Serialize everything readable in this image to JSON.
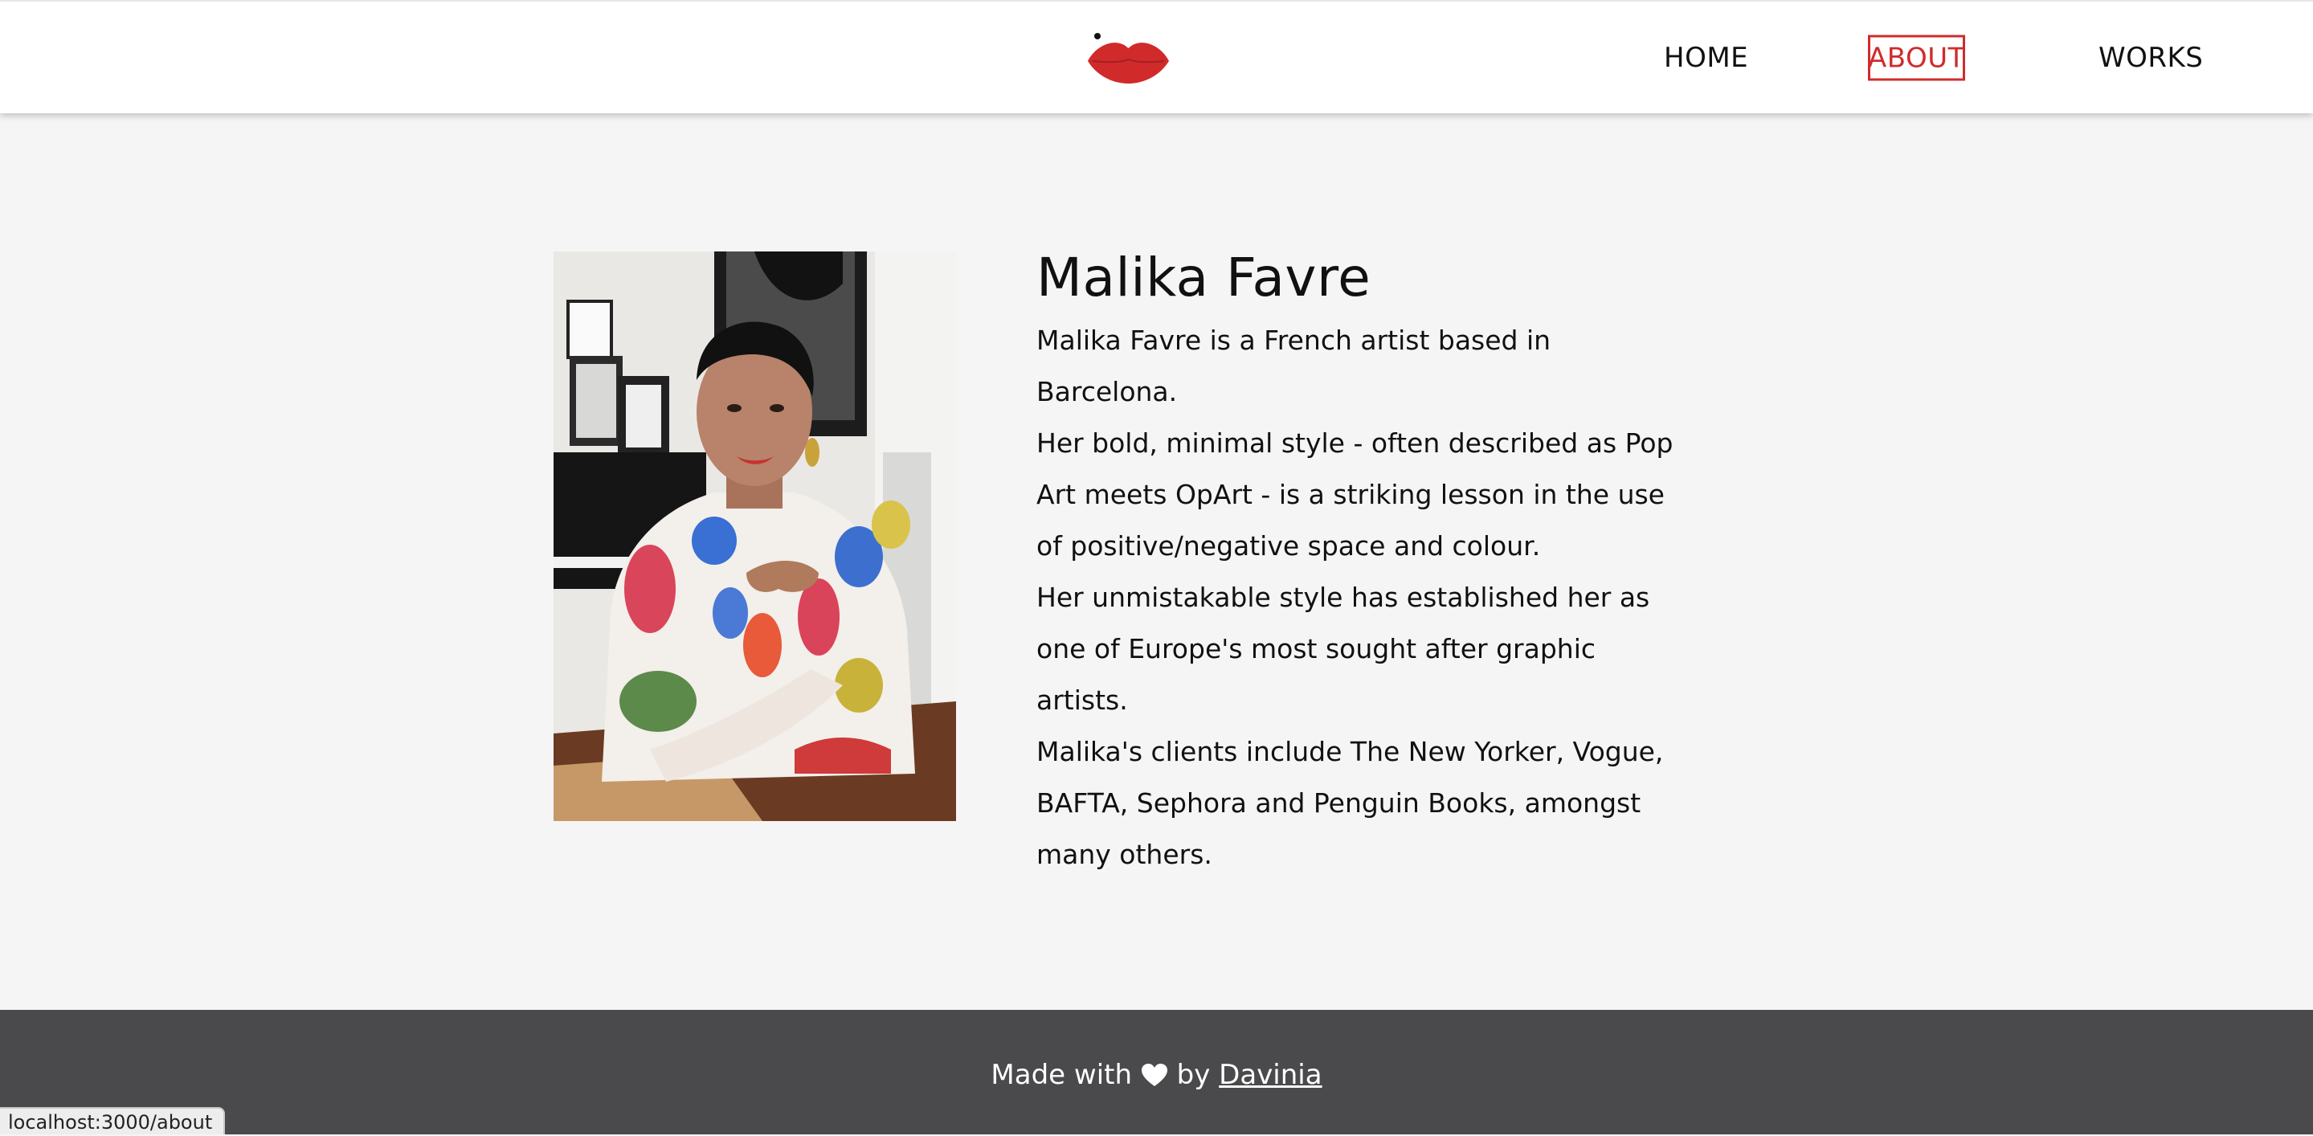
{
  "header": {
    "logo_icon": "red-lips-logo-icon",
    "nav": [
      {
        "label": "HOME",
        "active": false
      },
      {
        "label": "ABOUT",
        "active": true
      },
      {
        "label": "WORKS",
        "active": false
      }
    ]
  },
  "about": {
    "portrait_icon": "artist-portrait-photo",
    "name": "Malika Favre",
    "paragraphs": [
      "Malika Favre is a French artist based in Barcelona.",
      "Her bold, minimal style - often described as Pop Art meets OpArt - is a striking lesson in the use of positive/negative space and colour.",
      "Her unmistakable style has established her as one of Europe's most sought after graphic artists.",
      "Malika's clients include The New Yorker, Vogue, BAFTA, Sephora and Penguin Books, amongst many others."
    ]
  },
  "footer": {
    "prefix": "Made with",
    "heart_icon": "white-heart-icon",
    "by": "by",
    "author_link": "Davinia"
  },
  "status_bar": {
    "url": "localhost:3000/about"
  },
  "colors": {
    "accent": "#d02c2c",
    "header_bg": "#ffffff",
    "page_bg": "#f5f5f5",
    "footer_bg": "#4a494b"
  }
}
